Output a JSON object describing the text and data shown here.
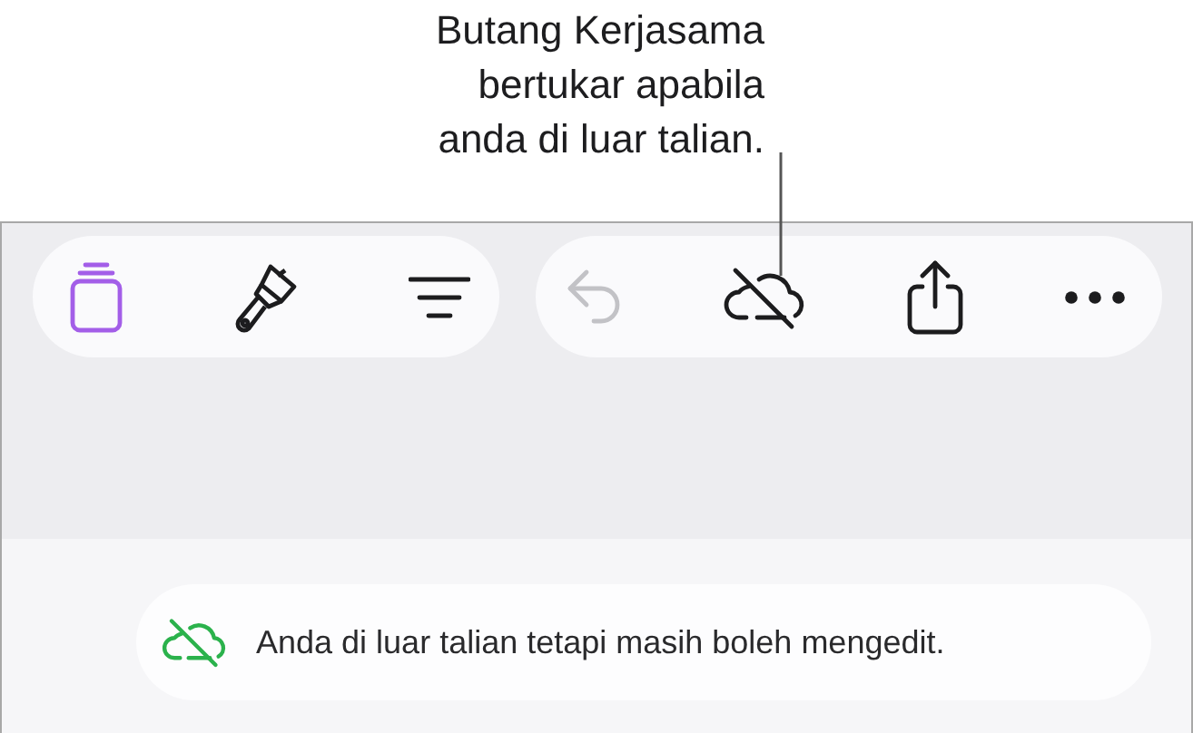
{
  "callout": {
    "lines": [
      "Butang Kerjasama",
      "bertukar apabila",
      "anda di luar talian."
    ]
  },
  "toolbar": {
    "left_group": [
      {
        "kind": "pages",
        "selected": true
      },
      {
        "kind": "brush",
        "selected": false
      },
      {
        "kind": "format",
        "selected": false
      }
    ],
    "right_group": [
      {
        "kind": "undo",
        "disabled": true
      },
      {
        "kind": "offline",
        "disabled": false
      },
      {
        "kind": "share",
        "disabled": false
      },
      {
        "kind": "more",
        "disabled": false
      }
    ]
  },
  "banner": {
    "text": "Anda di luar talian tetapi masih boleh mengedit."
  }
}
